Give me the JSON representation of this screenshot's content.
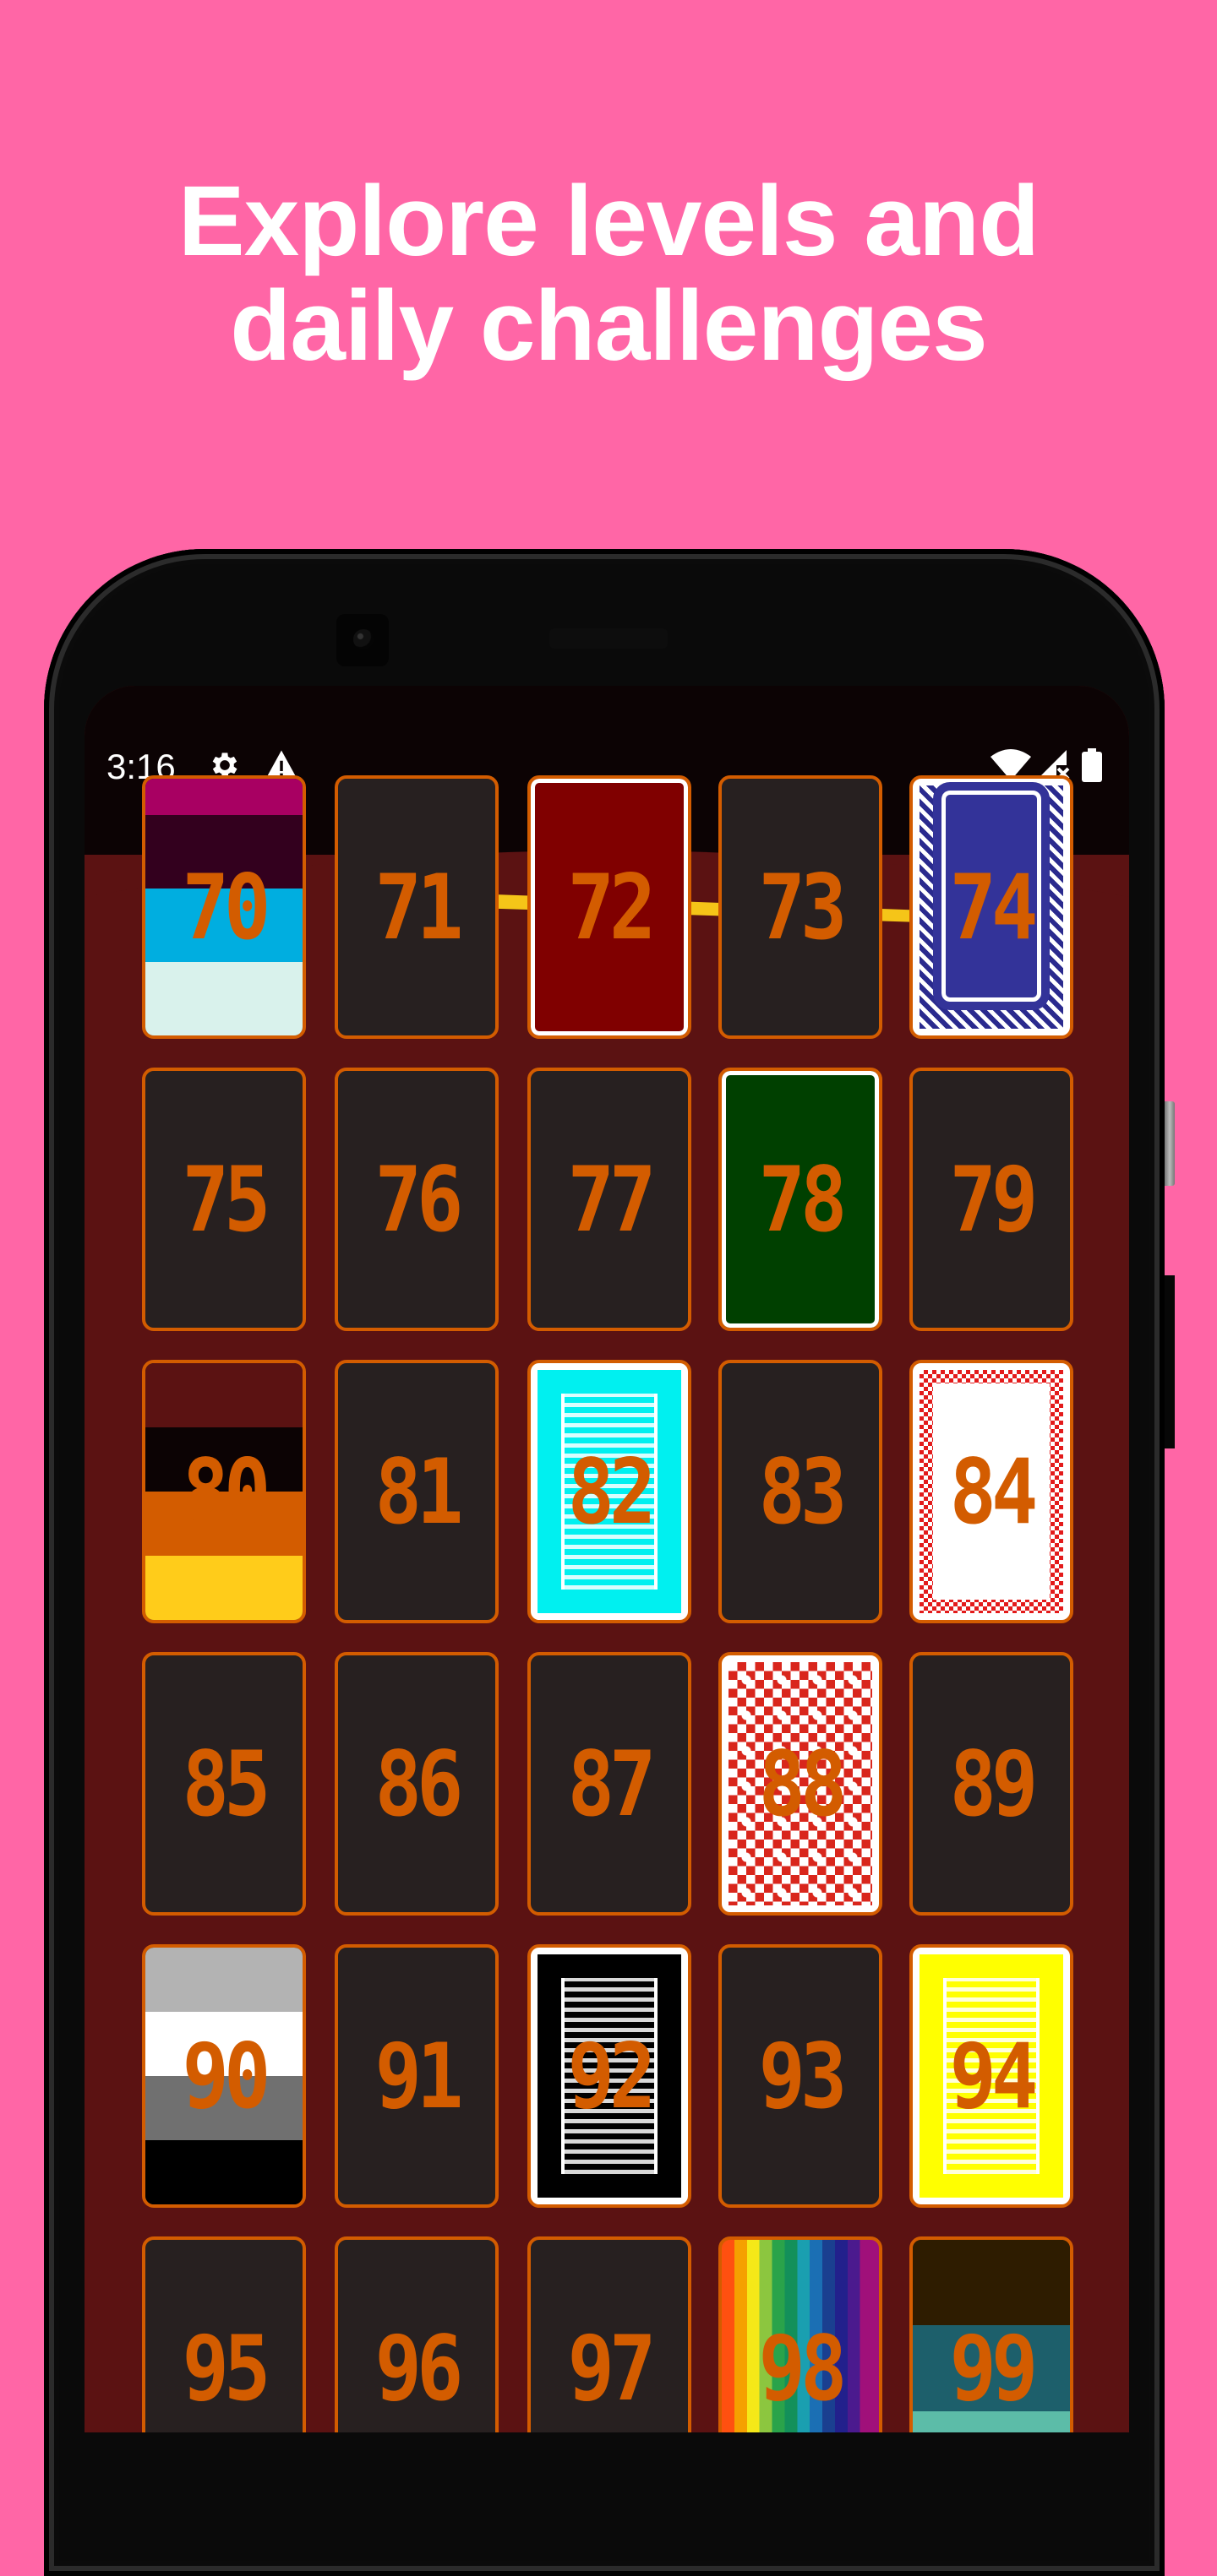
{
  "headline": {
    "line1": "Explore levels and",
    "line2": "daily challenges"
  },
  "status_bar": {
    "time": "3:16",
    "left_icons": [
      "gear-icon",
      "warning-icon"
    ],
    "right_icons": [
      "wifi-icon",
      "signal-no-service-icon",
      "battery-icon"
    ]
  },
  "theme": {
    "page_background": "#ff66a6",
    "app_background": "#5b1212",
    "card_border": "#d35c00",
    "card_default": "#272020",
    "number_color": "#d35c00",
    "accent_yellow": "#f5c518"
  },
  "levels": [
    {
      "number": "70",
      "style": "stripes",
      "colors": [
        "#a80062",
        "#33001e",
        "#33001e",
        "#00aee0",
        "#00aee0",
        "#d9f2ec",
        "#d9f2ec"
      ]
    },
    {
      "number": "71",
      "style": "plain"
    },
    {
      "number": "72",
      "style": "solid-framed",
      "colors": [
        "#800000"
      ]
    },
    {
      "number": "73",
      "style": "plain"
    },
    {
      "number": "74",
      "style": "pattern-blue"
    },
    {
      "number": "75",
      "style": "plain"
    },
    {
      "number": "76",
      "style": "plain"
    },
    {
      "number": "77",
      "style": "plain"
    },
    {
      "number": "78",
      "style": "solid-framed",
      "colors": [
        "#004000"
      ]
    },
    {
      "number": "79",
      "style": "plain"
    },
    {
      "number": "80",
      "style": "stripes",
      "colors": [
        "#5b1212",
        "#0c0304",
        "#d35c00",
        "#ffcc1a"
      ]
    },
    {
      "number": "81",
      "style": "plain"
    },
    {
      "number": "82",
      "style": "pattern-lines",
      "colors": [
        "#00f0f0"
      ]
    },
    {
      "number": "83",
      "style": "plain"
    },
    {
      "number": "84",
      "style": "checker"
    },
    {
      "number": "85",
      "style": "plain"
    },
    {
      "number": "86",
      "style": "plain"
    },
    {
      "number": "87",
      "style": "plain"
    },
    {
      "number": "88",
      "style": "quilt"
    },
    {
      "number": "89",
      "style": "plain"
    },
    {
      "number": "90",
      "style": "stripes",
      "colors": [
        "#b3b3b3",
        "#ffffff",
        "#707070",
        "#000000"
      ]
    },
    {
      "number": "91",
      "style": "plain"
    },
    {
      "number": "92",
      "style": "pattern-lines",
      "colors": [
        "#000000"
      ]
    },
    {
      "number": "93",
      "style": "plain"
    },
    {
      "number": "94",
      "style": "pattern-lines",
      "colors": [
        "#ffff00"
      ]
    },
    {
      "number": "95",
      "style": "plain"
    },
    {
      "number": "96",
      "style": "plain"
    },
    {
      "number": "97",
      "style": "plain"
    },
    {
      "number": "98",
      "style": "rainbow"
    },
    {
      "number": "99",
      "style": "stripes",
      "colors": [
        "#2e1c00",
        "#1d5f6b",
        "#5cbca8"
      ]
    }
  ]
}
